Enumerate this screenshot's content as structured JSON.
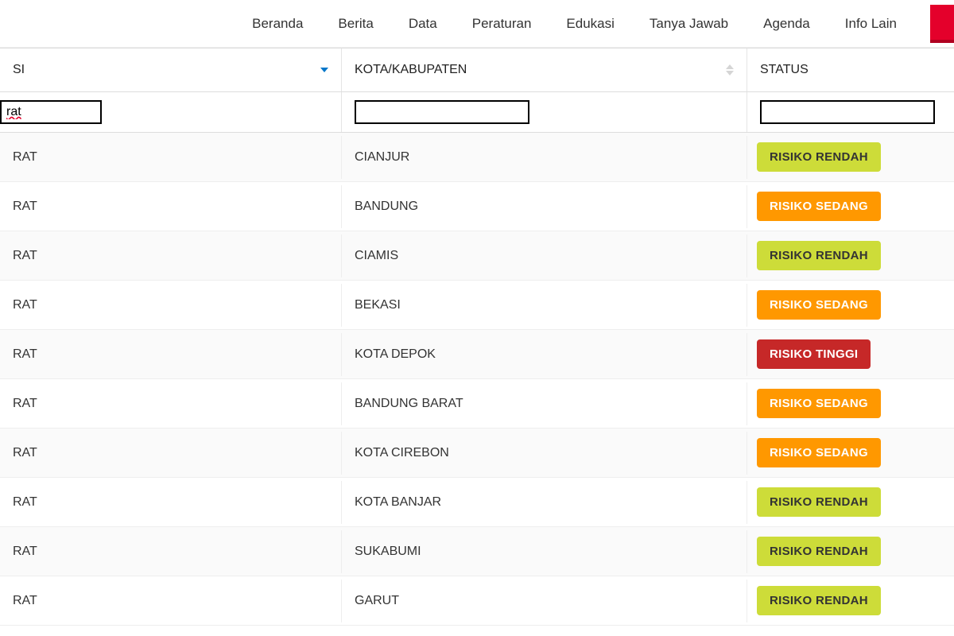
{
  "nav": {
    "items": [
      "Beranda",
      "Berita",
      "Data",
      "Peraturan",
      "Edukasi",
      "Tanya Jawab",
      "Agenda",
      "Info Lain"
    ]
  },
  "table": {
    "headers": {
      "provinsi": "SI",
      "kota": "KOTA/KABUPATEN",
      "status": "STATUS"
    },
    "filters": {
      "provinsi": "rat",
      "kota": "",
      "status": ""
    },
    "rows": [
      {
        "provinsi": "RAT",
        "kota": "CIANJUR",
        "status": "RISIKO RENDAH",
        "level": "rendah"
      },
      {
        "provinsi": "RAT",
        "kota": "BANDUNG",
        "status": "RISIKO SEDANG",
        "level": "sedang"
      },
      {
        "provinsi": "RAT",
        "kota": "CIAMIS",
        "status": "RISIKO RENDAH",
        "level": "rendah"
      },
      {
        "provinsi": "RAT",
        "kota": "BEKASI",
        "status": "RISIKO SEDANG",
        "level": "sedang"
      },
      {
        "provinsi": "RAT",
        "kota": "KOTA DEPOK",
        "status": "RISIKO TINGGI",
        "level": "tinggi"
      },
      {
        "provinsi": "RAT",
        "kota": "BANDUNG BARAT",
        "status": "RISIKO SEDANG",
        "level": "sedang"
      },
      {
        "provinsi": "RAT",
        "kota": "KOTA CIREBON",
        "status": "RISIKO SEDANG",
        "level": "sedang"
      },
      {
        "provinsi": "RAT",
        "kota": "KOTA BANJAR",
        "status": "RISIKO RENDAH",
        "level": "rendah"
      },
      {
        "provinsi": "RAT",
        "kota": "SUKABUMI",
        "status": "RISIKO RENDAH",
        "level": "rendah"
      },
      {
        "provinsi": "RAT",
        "kota": "GARUT",
        "status": "RISIKO RENDAH",
        "level": "rendah"
      }
    ]
  },
  "colors": {
    "brand_red": "#e4002b",
    "rendah": "#cddc39",
    "sedang": "#ff9800",
    "tinggi": "#c62828"
  }
}
